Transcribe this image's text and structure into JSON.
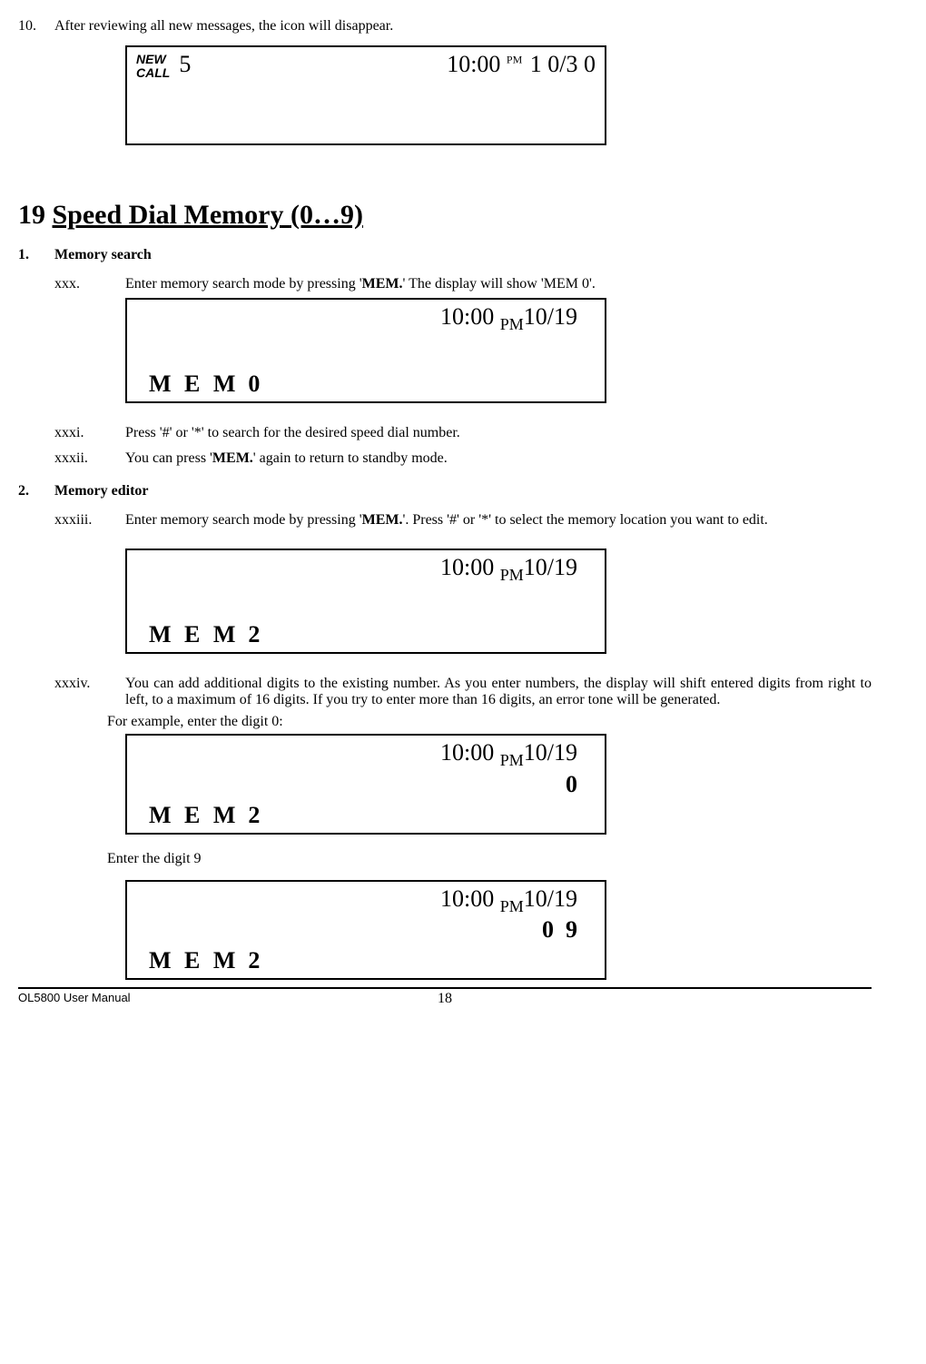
{
  "step10": {
    "num": "10.",
    "text": "After reviewing all new messages, the icon will disappear."
  },
  "display1": {
    "newcall_line1": "NEW",
    "newcall_line2": "CALL",
    "count": "5",
    "time": "10:00",
    "pm": "PM",
    "right": "1 0/3 0"
  },
  "section_heading_num": "19",
  "section_heading_text": "Speed Dial Memory (0…9)",
  "sub1": {
    "num": "1.",
    "text": "Memory search"
  },
  "xxx": {
    "roman": "xxx.",
    "text_pre": "Enter memory search mode by pressing '",
    "mem": "MEM.",
    "text_post": "'  The display will show 'MEM 0'."
  },
  "displayA": {
    "time": "10:00",
    "pm": "PM",
    "date": "10/19",
    "mem": "M E M",
    "memnum": "0"
  },
  "xxxi": {
    "roman": "xxxi.",
    "text": "Press '#' or '*' to search for the desired speed dial number."
  },
  "xxxii": {
    "roman": "xxxii.",
    "text_pre": "You can press '",
    "mem": "MEM.",
    "text_post": "' again to return to standby mode."
  },
  "sub2": {
    "num": "2.",
    "text": "Memory editor"
  },
  "xxxiii": {
    "roman": "xxxiii.",
    "text_pre": "Enter memory search mode by pressing '",
    "mem": "MEM.",
    "text_post": "'. Press '#' or '*' to select the memory location you want to edit."
  },
  "displayB": {
    "time": "10:00",
    "pm": "PM",
    "date": "10/19",
    "mem": "M E M",
    "memnum": "2"
  },
  "xxxiv": {
    "roman": "xxxiv.",
    "text": "You can add additional digits to the existing number.  As you enter numbers, the display will shift entered digits from right to left, to a maximum of 16 digits.  If you try to enter more than 16 digits, an error tone will be generated."
  },
  "example0": "For example, enter the digit 0:",
  "displayC": {
    "time": "10:00",
    "pm": "PM",
    "date": "10/19",
    "digits": "0",
    "mem": "M E M",
    "memnum": "2"
  },
  "enter9": "Enter the digit 9",
  "displayD": {
    "time": "10:00",
    "pm": "PM",
    "date": "10/19",
    "digits": "0  9",
    "mem": "M E M",
    "memnum": "2"
  },
  "footer": {
    "manual": "OL5800 User Manual",
    "page": "18"
  }
}
